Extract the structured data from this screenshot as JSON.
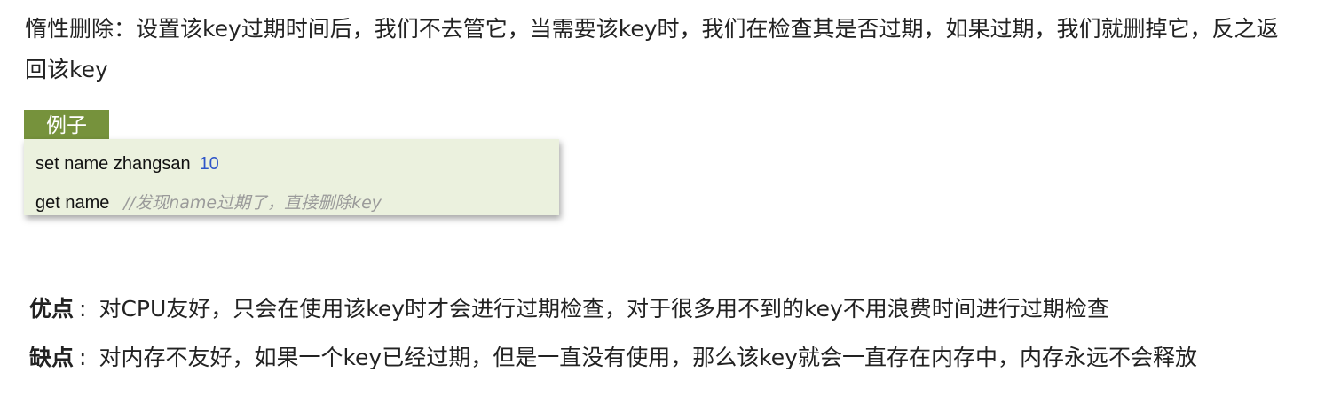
{
  "intro": {
    "text": "惰性删除：设置该key过期时间后，我们不去管它，当需要该key时，我们在检查其是否过期，如果过期，我们就删掉它，反之返回该key"
  },
  "example": {
    "tag_label": "例子",
    "line1_cmd": "set name zhangsan",
    "line1_value": "10",
    "line2_cmd": "get name",
    "line2_comment": "//发现name过期了，直接删除key"
  },
  "pros": {
    "label": "优点",
    "colon": ":",
    "text": "对CPU友好，只会在使用该key时才会进行过期检查，对于很多用不到的key不用浪费时间进行过期检查"
  },
  "cons": {
    "label": "缺点",
    "colon": ":",
    "text": "对内存不友好，如果一个key已经过期，但是一直没有使用，那么该key就会一直存在内存中，内存永远不会释放"
  },
  "colors": {
    "tag_bg": "#76923c",
    "code_bg": "#ebf1de",
    "number": "#2f56c9",
    "comment": "#9a9a9a"
  }
}
